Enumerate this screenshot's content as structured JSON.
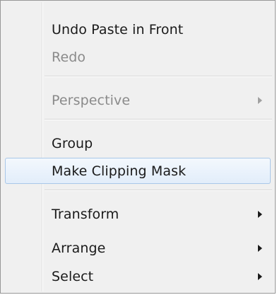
{
  "menu": {
    "items": [
      {
        "label": "Undo Paste in Front",
        "enabled": true,
        "submenu": false
      },
      {
        "label": "Redo",
        "enabled": false,
        "submenu": false
      },
      {
        "label": "Perspective",
        "enabled": false,
        "submenu": true
      },
      {
        "label": "Group",
        "enabled": true,
        "submenu": false
      },
      {
        "label": "Make Clipping Mask",
        "enabled": true,
        "submenu": false,
        "highlighted": true
      },
      {
        "label": "Transform",
        "enabled": true,
        "submenu": true
      },
      {
        "label": "Arrange",
        "enabled": true,
        "submenu": true
      },
      {
        "label": "Select",
        "enabled": true,
        "submenu": true
      }
    ],
    "highlight_color": "#e2edfa",
    "highlight_border_color": "#a9c7e8",
    "disabled_text_color": "#8a8a8a",
    "icons": {
      "submenu": "chevron-right-icon"
    }
  }
}
